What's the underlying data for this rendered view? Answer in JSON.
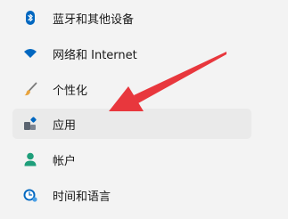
{
  "sidebar": {
    "items": [
      {
        "label": "蓝牙和其他设备",
        "icon": "bluetooth-icon"
      },
      {
        "label": "网络和 Internet",
        "icon": "wifi-icon"
      },
      {
        "label": "个性化",
        "icon": "brush-icon"
      },
      {
        "label": "应用",
        "icon": "apps-icon"
      },
      {
        "label": "帐户",
        "icon": "account-icon"
      },
      {
        "label": "时间和语言",
        "icon": "time-language-icon"
      }
    ],
    "selected_item": "应用"
  },
  "colors": {
    "background": "#f3f3f3",
    "selected_bg": "#eaeaea",
    "accent_blue": "#0067c0",
    "account_green": "#1e9e7a",
    "annotation_red": "#e8373d"
  }
}
